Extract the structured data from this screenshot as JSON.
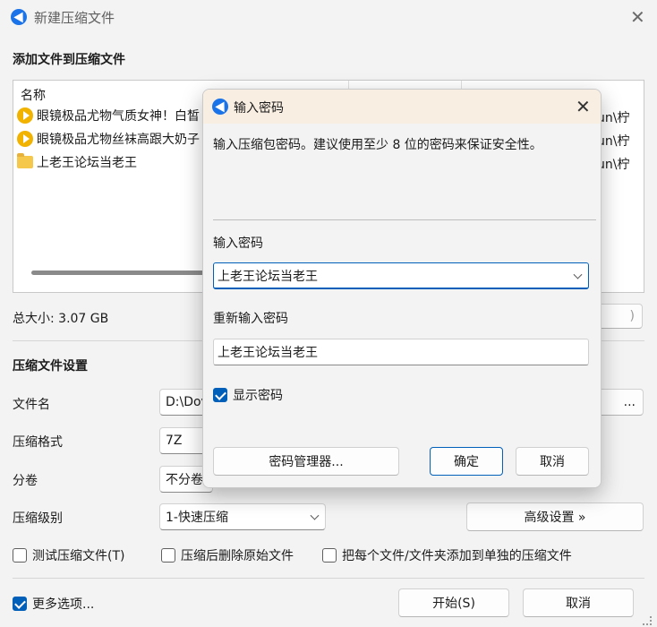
{
  "window": {
    "title": "新建压缩文件"
  },
  "add_files": {
    "section_title": "添加文件到压缩文件",
    "column_name": "名称",
    "items": [
      {
        "name": "眼镜极品尤物气质女神！白皙",
        "path_fragment": "un\\柠",
        "icon": "video-icon"
      },
      {
        "name": "眼镜极品尤物丝袜高跟大奶子",
        "path_fragment": "un\\柠",
        "icon": "video-icon"
      },
      {
        "name": "上老王论坛当老王",
        "path_fragment": "un\\柠",
        "icon": "folder-icon"
      }
    ],
    "total_size": "总大小: 3.07 GB",
    "right_button_fragment": ")"
  },
  "settings": {
    "section_title": "压缩文件设置",
    "filename_label": "文件名",
    "filename_value": "D:\\Dov",
    "browse_fragment": "...",
    "format_label": "压缩格式",
    "format_value": "7Z",
    "split_label": "分卷",
    "split_value": "不分卷",
    "level_label": "压缩级别",
    "level_value": "1-快速压缩",
    "advanced_button": "高级设置 »",
    "test_label": "测试压缩文件(T)",
    "delete_label": "压缩后删除原始文件",
    "separate_label": "把每个文件/文件夹添加到单独的压缩文件"
  },
  "footer": {
    "more_options": "更多选项...",
    "start_button": "开始(S)",
    "cancel_button": "取消"
  },
  "password_dialog": {
    "title": "输入密码",
    "description": "输入压缩包密码。建议使用至少 8 位的密码来保证安全性。",
    "password_label": "输入密码",
    "password_value": "上老王论坛当老王",
    "repeat_label": "重新输入密码",
    "repeat_value": "上老王论坛当老王",
    "show_password": "显示密码",
    "manager_button": "密码管理器...",
    "ok_button": "确定",
    "cancel_button": "取消"
  },
  "colors": {
    "accent": "#005fb8",
    "dialog_header": "#f9eee2",
    "background": "#f3f3f3"
  }
}
